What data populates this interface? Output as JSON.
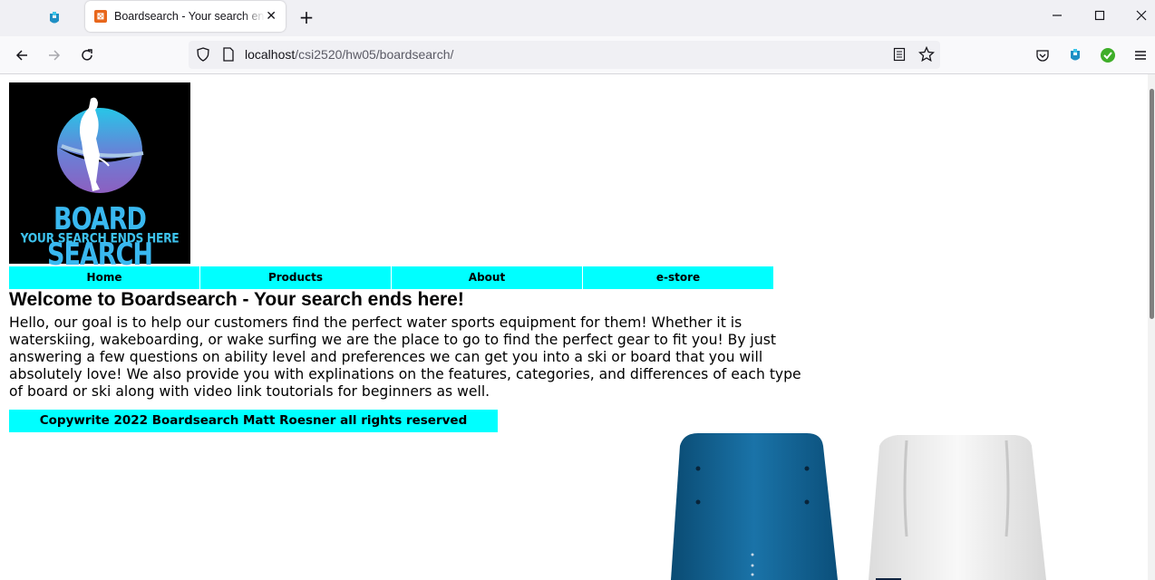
{
  "browser": {
    "tab_title": "Boardsearch - Your search ends here!",
    "url_host": "localhost",
    "url_path": "/csi2520/hw05/boardsearch/"
  },
  "logo": {
    "title_line": "BOARD SEARCH",
    "tagline": "YOUR SEARCH ENDS HERE"
  },
  "nav": {
    "items": [
      {
        "label": "Home"
      },
      {
        "label": "Products"
      },
      {
        "label": "About"
      },
      {
        "label": "e-store"
      }
    ]
  },
  "main": {
    "heading": "Welcome to Boardsearch - Your search ends here!",
    "intro": "Hello, our goal is to help our customers find the perfect water sports equipment for them! Whether it is waterskiing, wakeboarding, or wake surfing we are the place to go to find the perfect gear to fit you! By just answering a few questions on ability level and preferences we can get you into a ski or board that you will absolutely love! We also provide you with explinations on the features, categories, and differences of each type of board or ski along with video link toutorials for beginners as well."
  },
  "footer": {
    "text": "Copywrite 2022 Boardsearch Matt Roesner all rights reserved"
  },
  "colors": {
    "accent_cyan": "#00ffff",
    "logo_background": "#000000",
    "board_blue": "#0f5a85",
    "board_white": "#f1f1f1"
  },
  "icons": [
    "extension-icon",
    "tab-favicon",
    "close-icon",
    "plus-icon",
    "minimize-icon",
    "maximize-icon",
    "window-close-icon",
    "back-arrow-icon",
    "forward-arrow-icon",
    "reload-icon",
    "shield-icon",
    "page-icon",
    "reader-mode-icon",
    "star-icon",
    "pocket-icon",
    "extension-icon",
    "check-icon",
    "menu-icon"
  ]
}
